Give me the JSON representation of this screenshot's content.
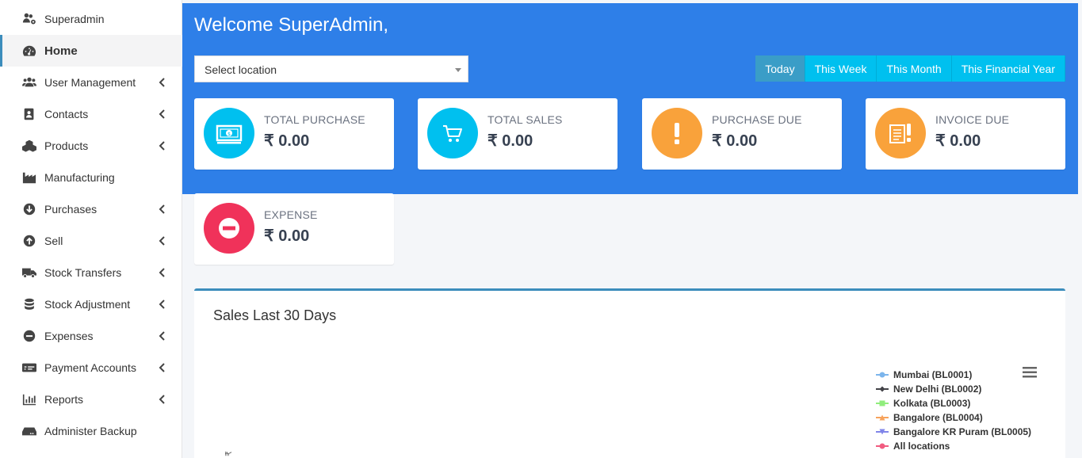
{
  "sidebar": {
    "items": [
      {
        "label": "Superadmin",
        "icon": "users-cog-icon",
        "chevron": false
      },
      {
        "label": "Home",
        "icon": "tachometer-icon",
        "chevron": false,
        "active": true
      },
      {
        "label": "User Management",
        "icon": "users-icon",
        "chevron": true
      },
      {
        "label": "Contacts",
        "icon": "address-book-icon",
        "chevron": true
      },
      {
        "label": "Products",
        "icon": "cubes-icon",
        "chevron": true
      },
      {
        "label": "Manufacturing",
        "icon": "industry-icon",
        "chevron": false
      },
      {
        "label": "Purchases",
        "icon": "arrow-circle-down-icon",
        "chevron": true
      },
      {
        "label": "Sell",
        "icon": "arrow-circle-up-icon",
        "chevron": true
      },
      {
        "label": "Stock Transfers",
        "icon": "truck-icon",
        "chevron": true
      },
      {
        "label": "Stock Adjustment",
        "icon": "database-icon",
        "chevron": true
      },
      {
        "label": "Expenses",
        "icon": "minus-circle-icon",
        "chevron": true
      },
      {
        "label": "Payment Accounts",
        "icon": "money-check-icon",
        "chevron": true
      },
      {
        "label": "Reports",
        "icon": "bar-chart-icon",
        "chevron": true
      },
      {
        "label": "Administer Backup",
        "icon": "hdd-icon",
        "chevron": false
      }
    ]
  },
  "header": {
    "welcome": "Welcome SuperAdmin,",
    "location_placeholder": "Select location",
    "date_filters": [
      "Today",
      "This Week",
      "This Month",
      "This Financial Year"
    ],
    "active_filter": "Today"
  },
  "cards": [
    {
      "label": "TOTAL PURCHASE",
      "value": "₹ 0.00",
      "icon": "money-bill-icon",
      "color": "#00c0ef"
    },
    {
      "label": "TOTAL SALES",
      "value": "₹ 0.00",
      "icon": "shopping-cart-icon",
      "color": "#00c0ef"
    },
    {
      "label": "PURCHASE DUE",
      "value": "₹ 0.00",
      "icon": "exclamation-icon",
      "color": "#f39c12"
    },
    {
      "label": "INVOICE DUE",
      "value": "₹ 0.00",
      "icon": "invoice-exclamation-icon",
      "color": "#f39c12"
    },
    {
      "label": "EXPENSE",
      "value": "₹ 0.00",
      "icon": "minus-circle-icon",
      "color": "#f0325a"
    }
  ],
  "sales_chart": {
    "title": "Sales Last 30 Days",
    "axis_label": "₹",
    "legend": [
      {
        "name": "Mumbai (BL0001)",
        "color": "#7cb5ec",
        "marker": "circle"
      },
      {
        "name": "New Delhi (BL0002)",
        "color": "#434348",
        "marker": "diamond"
      },
      {
        "name": "Kolkata (BL0003)",
        "color": "#90ed7d",
        "marker": "square"
      },
      {
        "name": "Bangalore (BL0004)",
        "color": "#f7a35c",
        "marker": "triangle"
      },
      {
        "name": "Bangalore KR Puram (BL0005)",
        "color": "#8085e9",
        "marker": "triangle-down"
      },
      {
        "name": "All locations",
        "color": "#f15c80",
        "marker": "circle"
      }
    ]
  }
}
